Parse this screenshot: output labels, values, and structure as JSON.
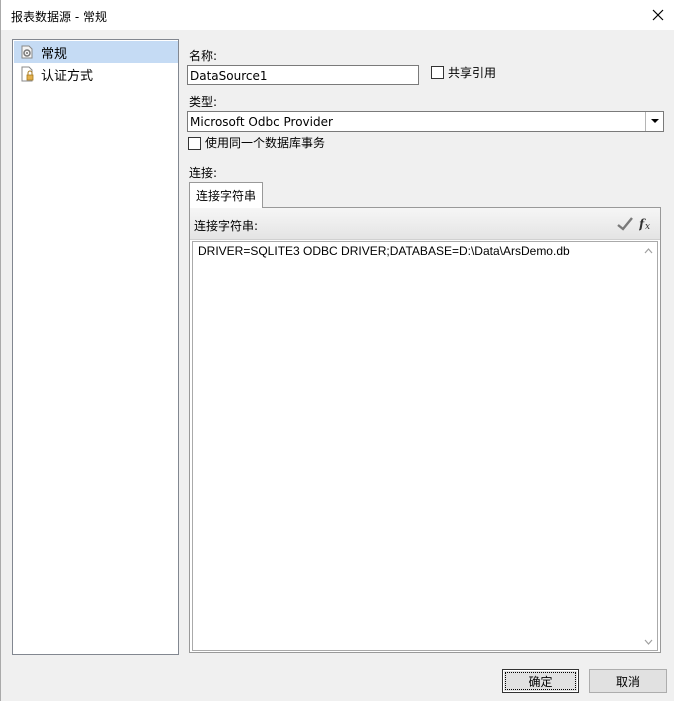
{
  "window": {
    "title": "报表数据源 - 常规"
  },
  "sidebar": {
    "items": [
      {
        "label": "常规",
        "icon": "gear-page-icon",
        "selected": true
      },
      {
        "label": "认证方式",
        "icon": "lock-page-icon",
        "selected": false
      }
    ]
  },
  "form": {
    "name_label": "名称:",
    "name_value": "DataSource1",
    "shared_ref_label": "共享引用",
    "type_label": "类型:",
    "type_value": "Microsoft Odbc Provider",
    "same_tx_label": "使用同一个数据库事务",
    "connection_label": "连接:",
    "tab_label": "连接字符串",
    "conn_string_label": "连接字符串:",
    "conn_string_value": "DRIVER=SQLITE3 ODBC DRIVER;DATABASE=D:\\Data\\ArsDemo.db"
  },
  "buttons": {
    "ok": "确定",
    "cancel": "取消"
  }
}
